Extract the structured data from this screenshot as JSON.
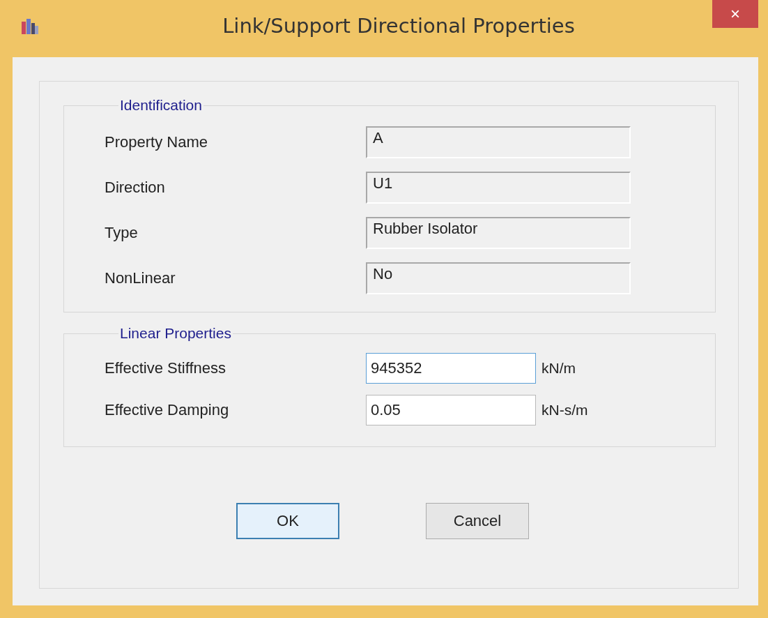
{
  "window": {
    "title": "Link/Support Directional Properties",
    "close": "×"
  },
  "identification": {
    "title": "Identification",
    "rows": [
      {
        "label": "Property Name",
        "value": "A"
      },
      {
        "label": "Direction",
        "value": "U1"
      },
      {
        "label": "Type",
        "value": "Rubber Isolator"
      },
      {
        "label": "NonLinear",
        "value": "No"
      }
    ]
  },
  "linear_properties": {
    "title": "Linear Properties",
    "rows": [
      {
        "label": "Effective Stiffness",
        "value": "945352",
        "unit": "kN/m",
        "focused": true
      },
      {
        "label": "Effective Damping",
        "value": "0.05",
        "unit": "kN-s/m",
        "focused": false
      }
    ]
  },
  "buttons": [
    {
      "label": "OK",
      "default": true
    },
    {
      "label": "Cancel",
      "default": false
    }
  ]
}
